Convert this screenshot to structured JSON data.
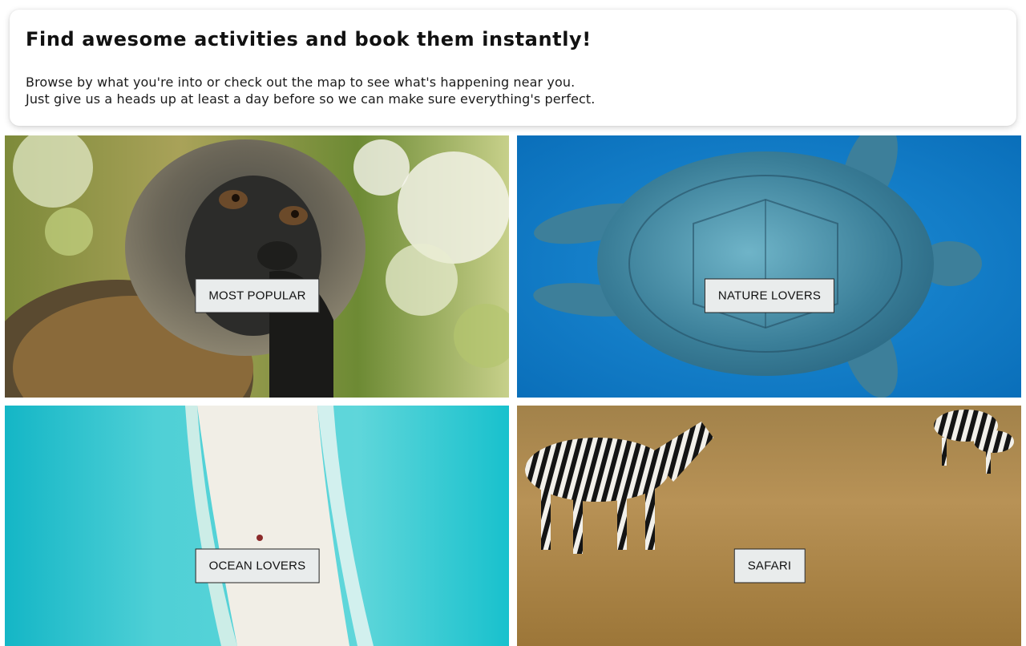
{
  "intro": {
    "title": "Find awesome activities and book them instantly!",
    "line1": "Browse by what you're into or check out the map to see what's happening near you.",
    "line2": "Just give us a heads up at least a day before so we can make sure everything's perfect."
  },
  "categories": [
    {
      "label": "MOST POPULAR",
      "image": "monkey-photo"
    },
    {
      "label": "NATURE LOVERS",
      "image": "sea-turtle-photo"
    },
    {
      "label": "OCEAN LOVERS",
      "image": "aerial-beach-photo"
    },
    {
      "label": "SAFARI",
      "image": "zebra-savanna-photo"
    }
  ]
}
